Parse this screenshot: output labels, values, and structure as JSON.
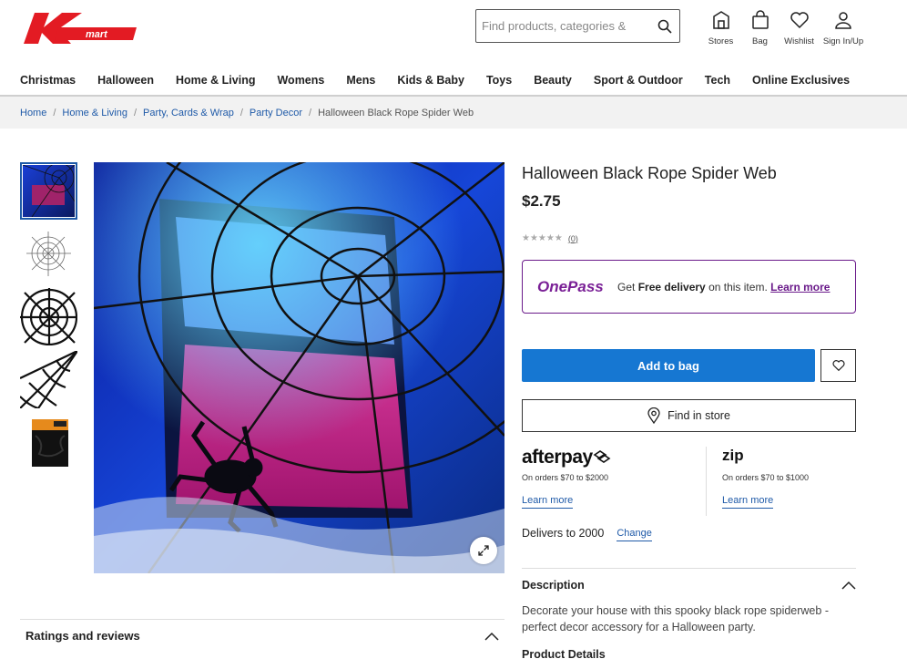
{
  "brand": {
    "logo_text": "Kmart",
    "color": "#e31b23"
  },
  "search": {
    "placeholder": "Find products, categories &"
  },
  "header_icons": [
    {
      "label": "Stores",
      "icon": "store-icon"
    },
    {
      "label": "Bag",
      "icon": "bag-icon"
    },
    {
      "label": "Wishlist",
      "icon": "heart-icon"
    },
    {
      "label": "Sign In/Up",
      "icon": "user-icon"
    }
  ],
  "nav": [
    "Christmas",
    "Halloween",
    "Home & Living",
    "Womens",
    "Mens",
    "Kids & Baby",
    "Toys",
    "Beauty",
    "Sport & Outdoor",
    "Tech",
    "Online Exclusives"
  ],
  "breadcrumb": [
    "Home",
    "Home & Living",
    "Party, Cards & Wrap",
    "Party Decor"
  ],
  "breadcrumb_current": "Halloween Black Rope Spider Web",
  "product": {
    "title": "Halloween Black Rope Spider Web",
    "price": "$2.75",
    "rating_count": "(0)",
    "rating_value": 0
  },
  "onepass": {
    "logo": "OnePass",
    "text_prefix": "Get",
    "text_bold": "Free delivery",
    "text_suffix": "on this item.",
    "learn_more": "Learn more"
  },
  "actions": {
    "add_to_bag": "Add to bag",
    "find_in_store": "Find in store"
  },
  "afterpay": {
    "logo": "afterpay",
    "orders": "On orders $70 to $2000",
    "learn_more": "Learn more"
  },
  "zip": {
    "logo": "zip",
    "orders": "On orders $70 to $1000",
    "learn_more": "Learn more"
  },
  "delivery": {
    "text": "Delivers to 2000",
    "change": "Change"
  },
  "description": {
    "heading": "Description",
    "body": "Decorate your house with this spooky black rope spiderweb - perfect decor accessory for a Halloween party.",
    "next_heading": "Product Details"
  },
  "ratings_section": {
    "heading": "Ratings and reviews"
  },
  "colors": {
    "primary_blue": "#1677d2",
    "onepass_purple": "#6a1a8a",
    "link_blue": "#1f5aa8"
  }
}
